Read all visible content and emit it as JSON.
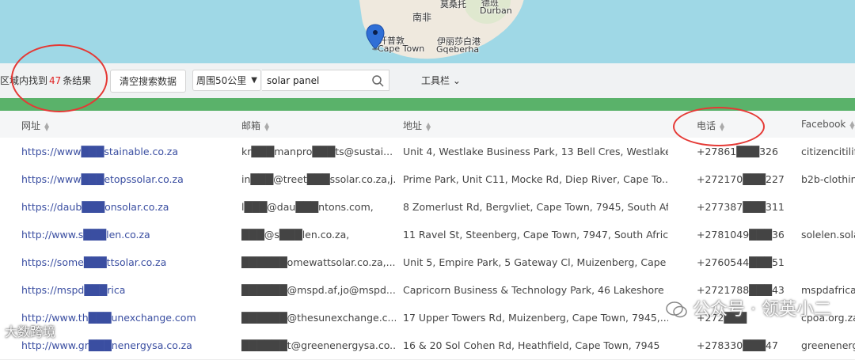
{
  "map": {
    "labels": {
      "south_africa": "南非",
      "mozambique": "莫桑托",
      "durban_cn": "德班",
      "durban": "Durban",
      "cape_town_cn": "开普敦",
      "cape_town": "Cape Town",
      "gqeberha_cn": "伊丽莎白港",
      "gqeberha": "Gqeberha"
    }
  },
  "toolbar": {
    "result_prefix": "区域内找到",
    "result_count": "47",
    "result_suffix": "条结果",
    "clear_label": "清空搜索数据",
    "radius_value": "周围50公里",
    "search_value": "solar panel",
    "tools_label": "工具栏 ⌄"
  },
  "table": {
    "headers": [
      "网址",
      "邮箱",
      "地址",
      "电话",
      "Facebook"
    ],
    "rows": [
      [
        "https://www███stainable.co.za",
        "kr███manpro███ts@sustai...",
        "Unit 4, Westlake Business Park, 13 Bell Cres, Westlake...",
        "+27861███326",
        "citizencitilif"
      ],
      [
        "https://www███etopssolar.co.za",
        "in███@treet███ssolar.co.za,j...",
        "Prime Park, Unit C11, Mocke Rd, Diep River, Cape To...",
        "+272170███227",
        "b2b-clothin"
      ],
      [
        "https://daub███onsolar.co.za",
        "l███@dau███ntons.com,",
        "8 Zomerlust Rd, Bergvliet, Cape Town, 7945, South Af...",
        "+277387███311",
        ""
      ],
      [
        "http://www.s███len.co.za",
        "███@s███len.co.za,",
        "11 Ravel St, Steenberg, Cape Town, 7947, South Africa",
        "+2781049███36",
        "solelen.sola"
      ],
      [
        "https://some███ttsolar.co.za",
        "██████omewattsolar.co.za,...",
        "Unit 5, Empire Park, 5 Gateway Cl, Muizenberg, Cape ...",
        "+2760544███51",
        ""
      ],
      [
        "https://mspd███rica",
        "██████@mspd.af,jo@mspd....",
        "Capricorn Business & Technology Park, 46 Lakeshore ...",
        "+2721788███43",
        "mspdafrica"
      ],
      [
        "http://www.th███unexchange.com",
        "██████@thesunexchange.c...",
        "17 Upper Towers Rd, Muizenberg, Cape Town, 7945,...",
        "+272███",
        "cpoa.org.za"
      ],
      [
        "http://www.gr███nenergysa.co.za",
        "██████t@greenenergysa.co...",
        "16 & 20 Sol Cohen Rd, Heathfield, Cape Town, 7945",
        "+278330███47",
        "greenenerg"
      ]
    ]
  },
  "watermark": {
    "main": "公众号 · 领英小二",
    "corner": "大数跨境"
  },
  "colors": {
    "accent_green": "#5ab26a",
    "link": "#3a4ea1",
    "annotation_red": "#e53935"
  }
}
